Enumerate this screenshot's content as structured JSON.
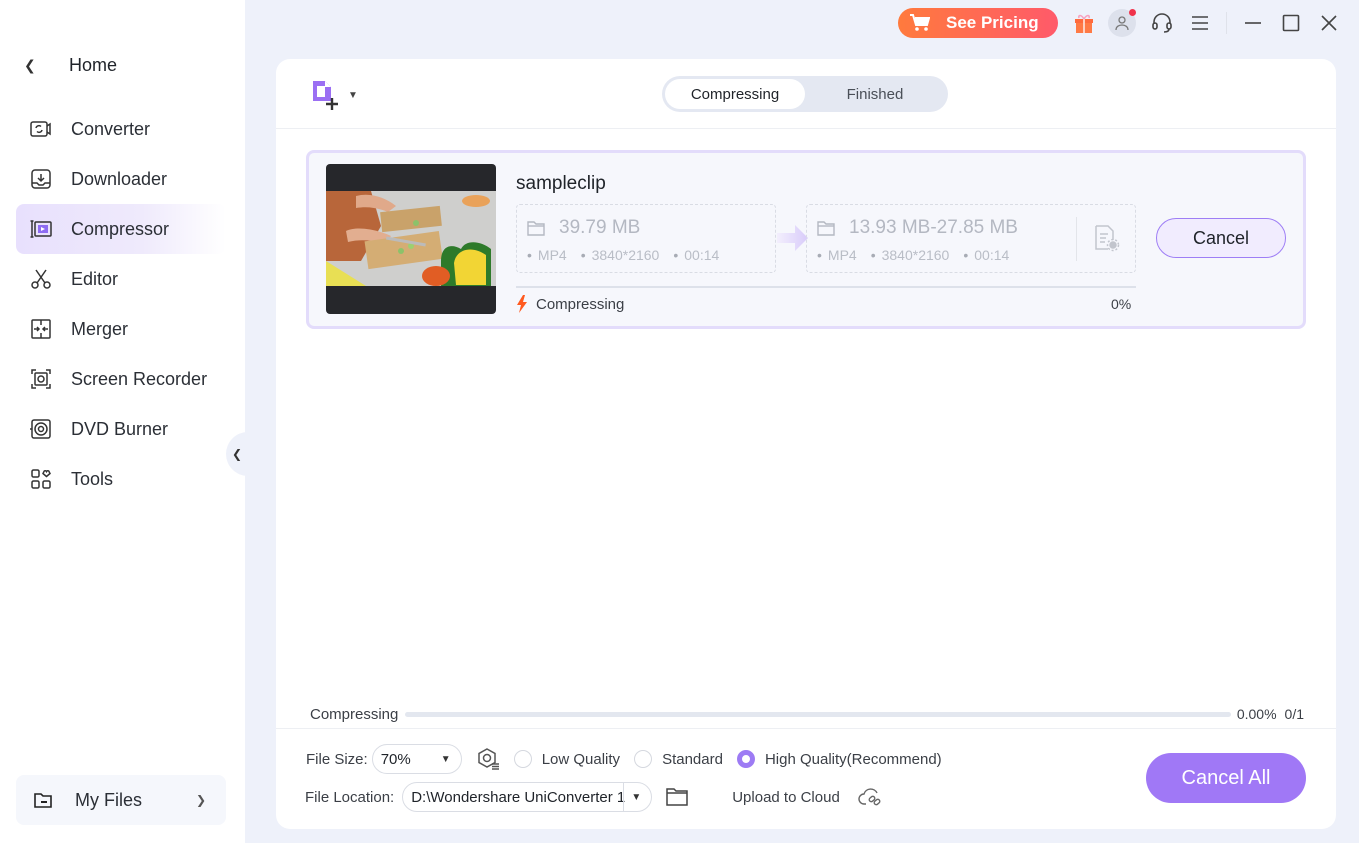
{
  "sidebar": {
    "home_label": "Home",
    "items": [
      {
        "label": "Converter",
        "icon": "converter-icon",
        "active": false
      },
      {
        "label": "Downloader",
        "icon": "downloader-icon",
        "active": false
      },
      {
        "label": "Compressor",
        "icon": "compressor-icon",
        "active": true
      },
      {
        "label": "Editor",
        "icon": "scissors-icon",
        "active": false
      },
      {
        "label": "Merger",
        "icon": "merger-icon",
        "active": false
      },
      {
        "label": "Screen Recorder",
        "icon": "screen-recorder-icon",
        "active": false
      },
      {
        "label": "DVD Burner",
        "icon": "disc-icon",
        "active": false
      },
      {
        "label": "Tools",
        "icon": "tools-grid-icon",
        "active": false
      }
    ],
    "my_files_label": "My Files"
  },
  "titlebar": {
    "pricing_label": "See Pricing",
    "icons": [
      "cart-icon",
      "gift-icon",
      "user-icon",
      "headset-icon",
      "menu-icon",
      "minimize-icon",
      "maximize-icon",
      "close-icon"
    ]
  },
  "tabs": [
    {
      "label": "Compressing",
      "active": true
    },
    {
      "label": "Finished",
      "active": false
    }
  ],
  "task": {
    "file_name": "sampleclip",
    "source": {
      "size": "39.79 MB",
      "format": "MP4",
      "resolution": "3840*2160",
      "duration": "00:14"
    },
    "target": {
      "size": "13.93 MB-27.85 MB",
      "format": "MP4",
      "resolution": "3840*2160",
      "duration": "00:14"
    },
    "status": "Compressing",
    "progress_label": "0%",
    "progress": 0,
    "cancel_label": "Cancel"
  },
  "overall": {
    "label": "Compressing",
    "percent": "0.00%",
    "count": "0/1",
    "progress": 0
  },
  "settings": {
    "file_size_label": "File Size:",
    "file_size_value": "70%",
    "quality_options": [
      {
        "label": "Low Quality",
        "checked": false
      },
      {
        "label": "Standard",
        "checked": false
      },
      {
        "label": "High Quality(Recommend)",
        "checked": true
      }
    ],
    "file_location_label": "File Location:",
    "file_location_value": "D:\\Wondershare UniConverter 1",
    "upload_label": "Upload to Cloud",
    "cancel_all_label": "Cancel All"
  },
  "colors": {
    "accent": "#a078f6",
    "pricing_start": "#ff7a3d",
    "pricing_end": "#ff5a6a",
    "status_bolt": "#ff5a1f"
  }
}
